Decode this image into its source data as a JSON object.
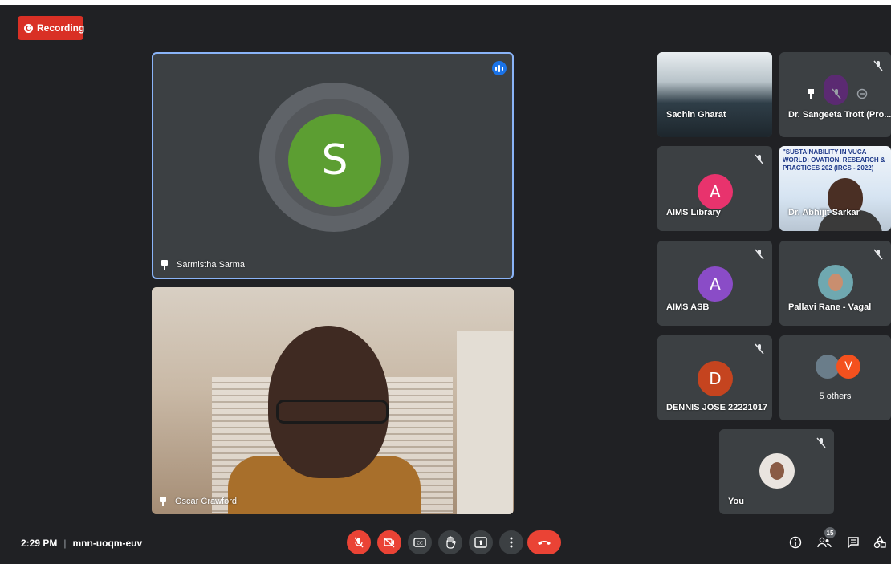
{
  "recording": {
    "label": "Recording"
  },
  "main_tiles": [
    {
      "name": "Sarmistha Sarma",
      "initial": "S",
      "avatar_color": "#5c9e32"
    },
    {
      "name": "Oscar Crawford"
    }
  ],
  "side_tiles": [
    {
      "name": "Sachin Gharat"
    },
    {
      "name": "Dr. Sangeeta Trott (Pro..."
    },
    {
      "name": "AIMS Library",
      "initial": "A",
      "avatar_color": "#e8336d"
    },
    {
      "name": "Dr. Abhijit Sarkar"
    },
    {
      "name": "AIMS ASB",
      "initial": "A",
      "avatar_color": "#8a4cc7"
    },
    {
      "name": "Pallavi Rane - Vagal"
    },
    {
      "name": "DENNIS JOSE 22221017",
      "initial": "D",
      "avatar_color": "#c5441f"
    },
    {
      "name": "5 others",
      "initial": "V",
      "avatar_color": "#f4511e"
    },
    {
      "name": "You"
    }
  ],
  "banner_text": "\"SUSTAINABILITY IN VUCA WORLD: OVATION, RESEARCH & PRACTICES 202 (IRCS - 2022)",
  "bottom_bar": {
    "time": "2:29 PM",
    "meeting_code": "mnn-uoqm-euv",
    "participant_count": "15"
  },
  "colors": {
    "background": "#202124",
    "tile": "#3c4043",
    "danger": "#ea4335",
    "active_border": "#8ab4f8"
  }
}
